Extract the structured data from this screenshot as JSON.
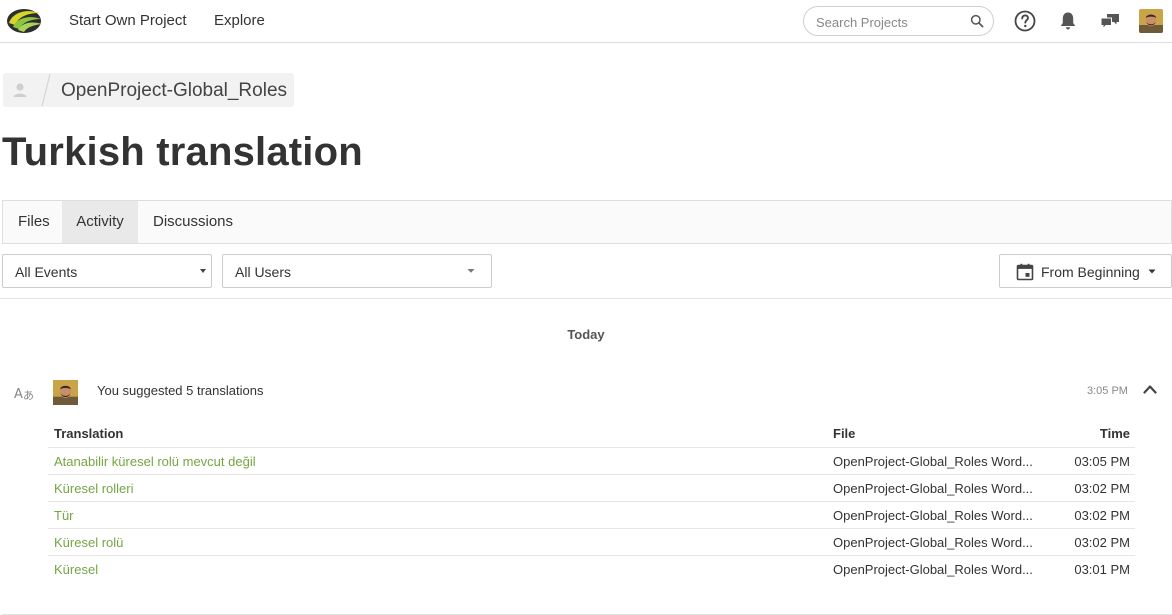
{
  "header": {
    "nav": {
      "start_project": "Start Own Project",
      "explore": "Explore"
    },
    "search": {
      "placeholder": "Search Projects",
      "value": ""
    },
    "icons": [
      "logo-icon",
      "search-icon",
      "help-icon",
      "bell-icon",
      "chat-icon",
      "avatar"
    ]
  },
  "breadcrumb": {
    "project": "OpenProject-Global_Roles"
  },
  "page": {
    "title": "Turkish translation"
  },
  "tabs": [
    {
      "label": "Files",
      "active": false
    },
    {
      "label": "Activity",
      "active": true
    },
    {
      "label": "Discussions",
      "active": false
    }
  ],
  "filters": {
    "events": "All Events",
    "users": "All Users",
    "date_range": "From Beginning"
  },
  "activity": {
    "day": "Today",
    "item": {
      "summary": "You suggested 5 translations",
      "time": "3:05 PM",
      "columns": {
        "translation": "Translation",
        "file": "File",
        "time": "Time"
      },
      "rows": [
        {
          "translation": "Atanabilir küresel rolü mevcut değil",
          "file": "OpenProject-Global_Roles Word...",
          "time": "03:05 PM"
        },
        {
          "translation": "Küresel rolleri",
          "file": "OpenProject-Global_Roles Word...",
          "time": "03:02 PM"
        },
        {
          "translation": "Tür",
          "file": "OpenProject-Global_Roles Word...",
          "time": "03:02 PM"
        },
        {
          "translation": "Küresel rolü",
          "file": "OpenProject-Global_Roles Word...",
          "time": "03:02 PM"
        },
        {
          "translation": "Küresel",
          "file": "OpenProject-Global_Roles Word...",
          "time": "03:01 PM"
        }
      ]
    }
  },
  "colors": {
    "link_green": "#76a544",
    "logo_green": "#8cc63f",
    "logo_yellow": "#d6d62a",
    "icon_gray": "#555555",
    "border": "#dedede"
  }
}
